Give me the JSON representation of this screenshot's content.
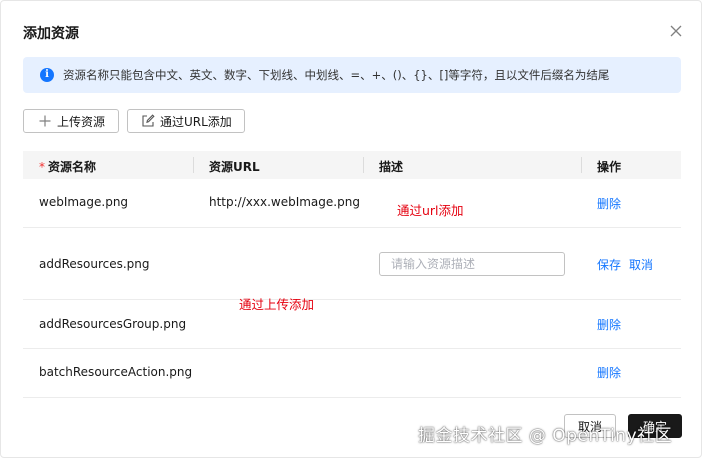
{
  "dialog": {
    "title": "添加资源",
    "alert": "资源名称只能包含中文、英文、数字、下划线、中划线、=、+、()、{}、[]等字符，且以文件后缀名为结尾"
  },
  "toolbar": {
    "upload_label": "上传资源",
    "url_label": "通过URL添加"
  },
  "table": {
    "headers": {
      "required_mark": "*",
      "name": "资源名称",
      "url": "资源URL",
      "desc": "描述",
      "action": "操作"
    },
    "rows": [
      {
        "name": "webImage.png",
        "url": "http://xxx.webImage.png",
        "action": "删除"
      },
      {
        "name": "addResources.png",
        "desc_placeholder": "请输入资源描述",
        "save": "保存",
        "cancel": "取消"
      },
      {
        "name": "addResourcesGroup.png",
        "action": "删除"
      },
      {
        "name": "batchResourceAction.png",
        "action": "删除"
      }
    ]
  },
  "annotations": {
    "url_add": "通过url添加",
    "upload_add": "通过上传添加"
  },
  "footer": {
    "cancel": "取消",
    "confirm": "确定"
  },
  "watermark": "掘金技术社区 @ OpenTiny社区",
  "colors": {
    "accent": "#1476ff",
    "alert_bg": "#e6f0ff",
    "annotation": "#e5000f",
    "required": "#f23030"
  }
}
